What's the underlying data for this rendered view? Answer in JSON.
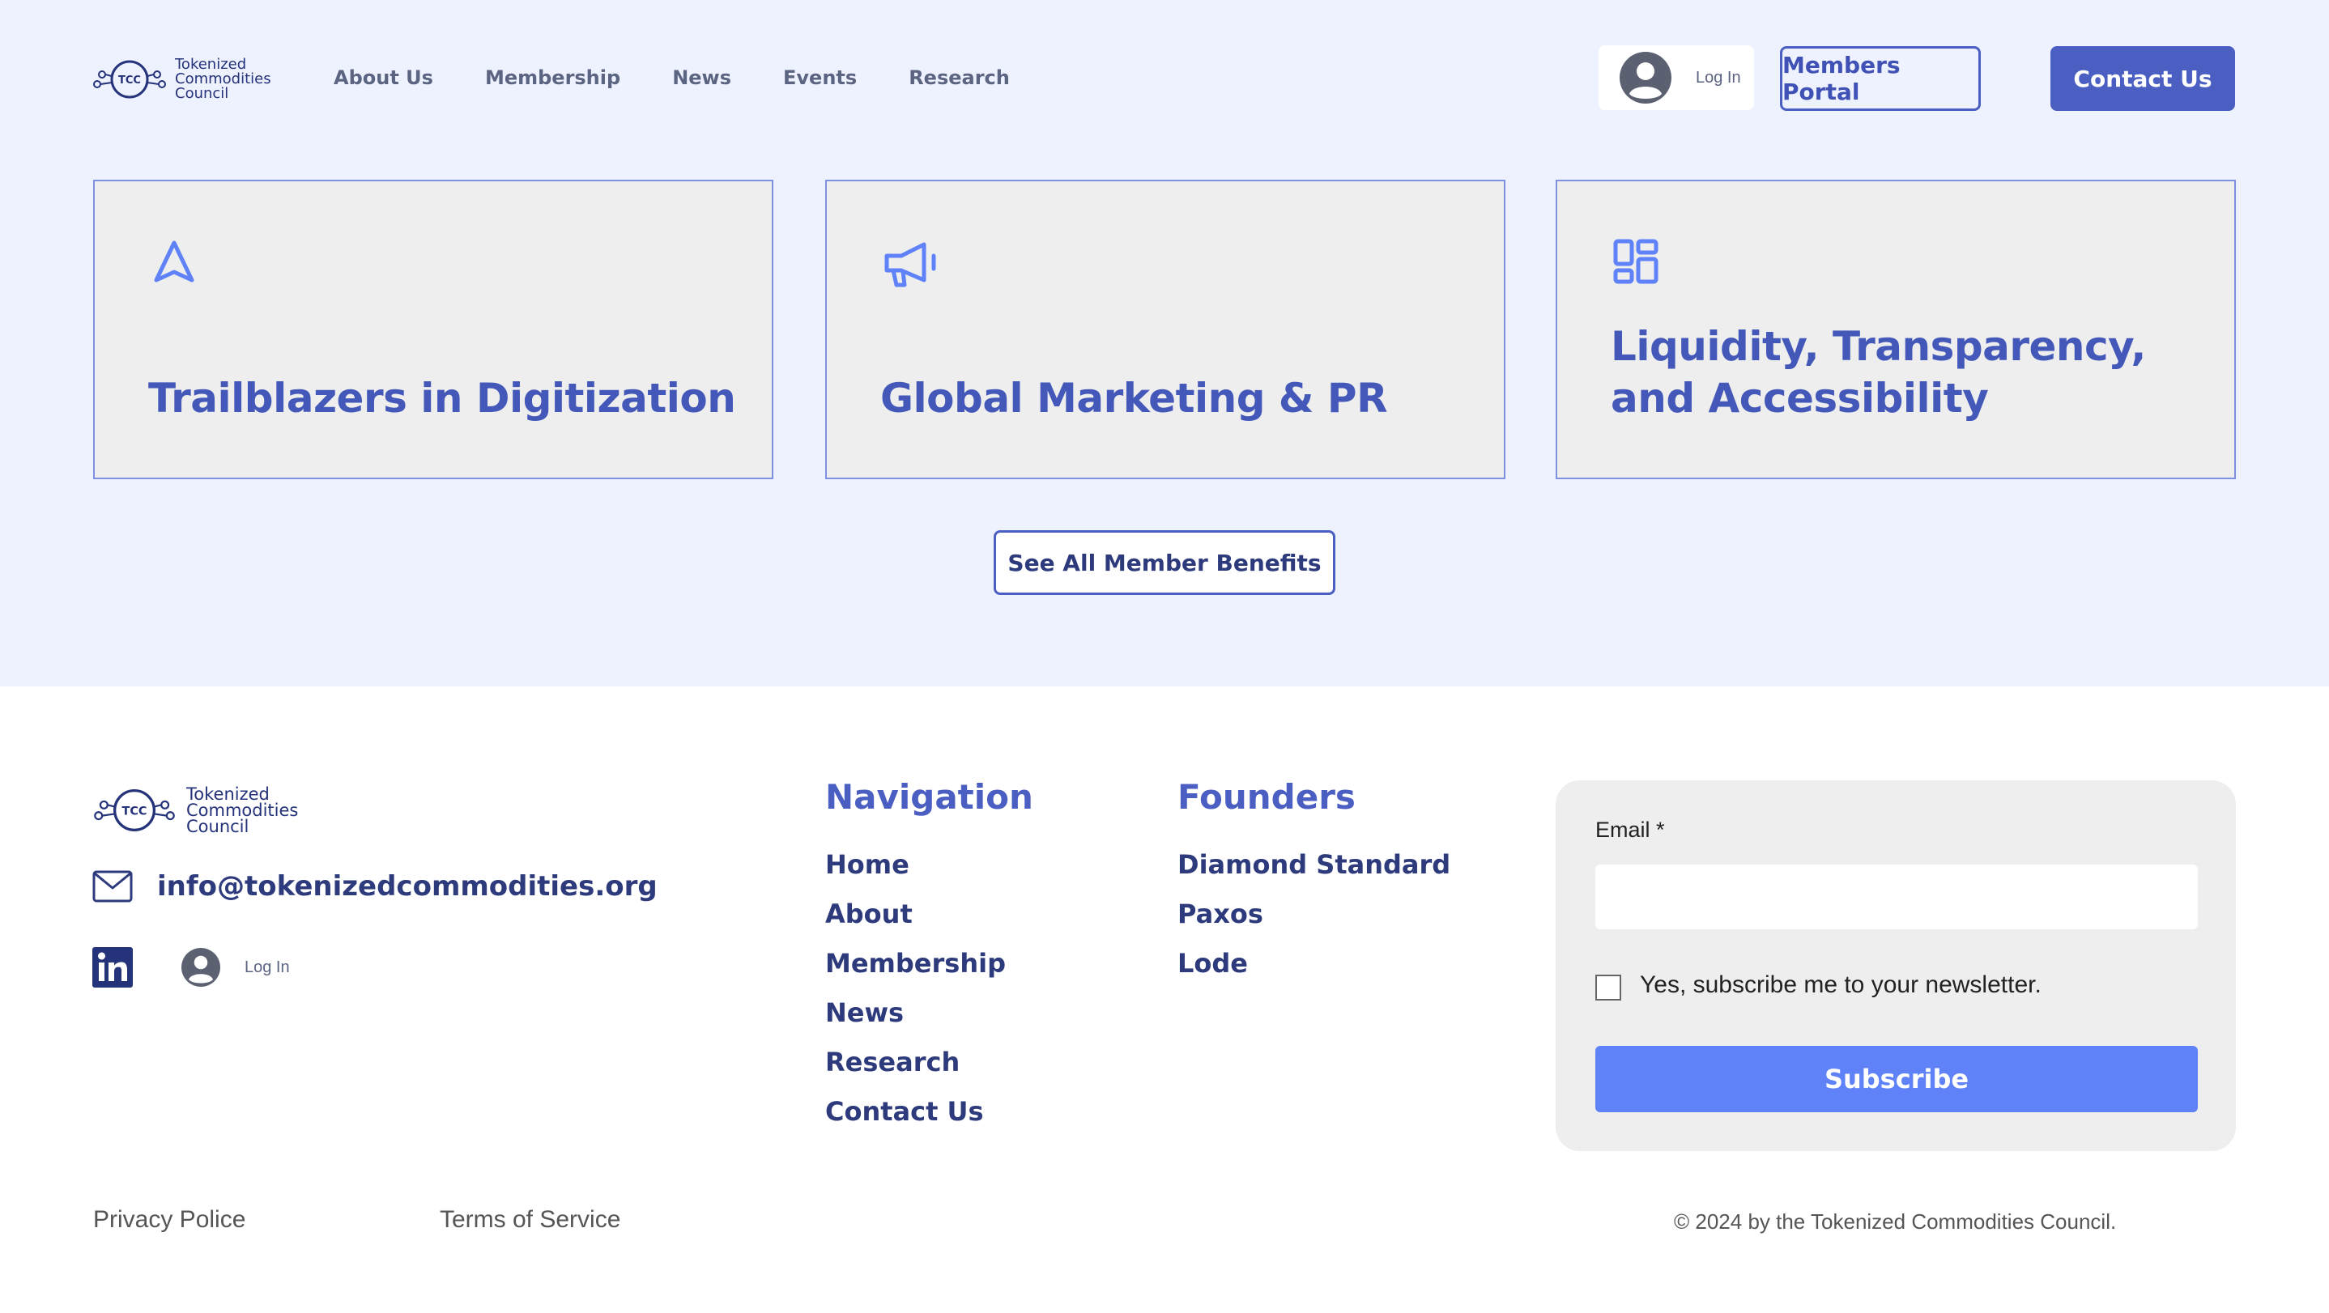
{
  "colors": {
    "background_top": "#eef1fe",
    "accent": "#4a5fc1",
    "card_bg": "#eeeeee",
    "subscribe_button": "#5f82f8",
    "text_dark": "#2d3a7c"
  },
  "header": {
    "logo": {
      "badge": "TCC",
      "line1": "Tokenized",
      "line2": "Commodities",
      "line3": "Council"
    },
    "nav": [
      "About Us",
      "Membership",
      "News",
      "Events",
      "Research"
    ],
    "login_label": "Log In",
    "members_portal": "Members Portal",
    "contact_us": "Contact Us"
  },
  "cards": [
    {
      "icon": "navigation-arrow-icon",
      "title": "Trailblazers  in Digitization"
    },
    {
      "icon": "megaphone-icon",
      "title": "Global Marketing  & PR"
    },
    {
      "icon": "dashboard-layout-icon",
      "title": "Liquidity, Transparency, and Accessibility"
    }
  ],
  "benefits_button": "See All Member Benefits",
  "footer": {
    "logo": {
      "badge": "TCC",
      "line1": "Tokenized",
      "line2": "Commodities",
      "line3": "Council"
    },
    "email": "info@tokenizedcommodities.org",
    "login_label": "Log In",
    "navigation": {
      "title": "Navigation",
      "items": [
        "Home",
        "About",
        "Membership",
        "News",
        "Research",
        "Contact Us"
      ]
    },
    "founders": {
      "title": "Founders",
      "items": [
        "Diamond Standard",
        "Paxos",
        "Lode"
      ]
    },
    "subscribe": {
      "email_label": "Email *",
      "email_value": "",
      "checkbox_label": "Yes, subscribe me to your newsletter.",
      "button": "Subscribe"
    },
    "privacy": "Privacy Police",
    "terms": "Terms of Service",
    "copyright": "© 2024 by the Tokenized Commodities Council."
  }
}
